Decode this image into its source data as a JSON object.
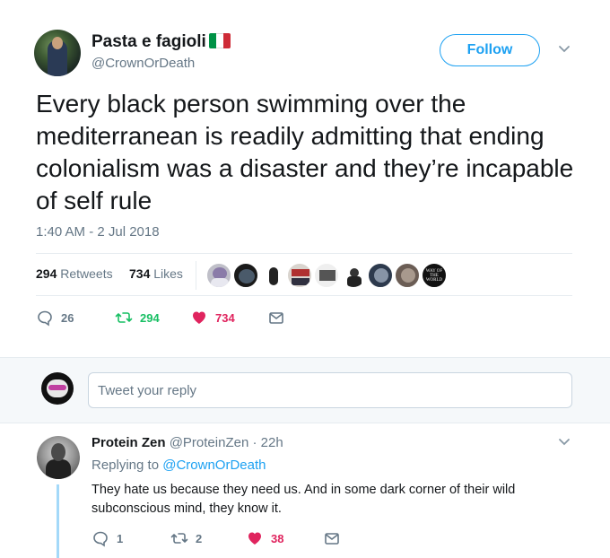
{
  "tweet": {
    "display_name": "Pasta e fagioli",
    "handle": "@CrownOrDeath",
    "follow_label": "Follow",
    "text": "Every black person swimming over the mediterranean is readily admitting that ending colonialism was a disaster and they’re incapable of self rule",
    "timestamp": "1:40 AM - 2 Jul 2018",
    "retweets_count": "294",
    "retweets_label": "Retweets",
    "likes_count": "734",
    "likes_label": "Likes",
    "liker_badge_text": "WAY OF THE WORLD",
    "actions": {
      "replies": "26",
      "retweets": "294",
      "likes": "734"
    }
  },
  "reply_box": {
    "placeholder": "Tweet your reply"
  },
  "reply": {
    "display_name": "Protein Zen",
    "handle": "@ProteinZen",
    "age": "· 22h",
    "replying_prefix": "Replying to",
    "replying_to": "@CrownOrDeath",
    "text": "They hate us because they need us. And in some dark corner of their wild subconscious mind, they know it.",
    "actions": {
      "replies": "1",
      "retweets": "2",
      "likes": "38"
    }
  },
  "colors": {
    "accent": "#1da1f2",
    "retweet": "#17bf63",
    "like": "#e0245e",
    "muted": "#657786"
  },
  "flag_colors": [
    "#009246",
    "#ffffff",
    "#ce2b37"
  ]
}
